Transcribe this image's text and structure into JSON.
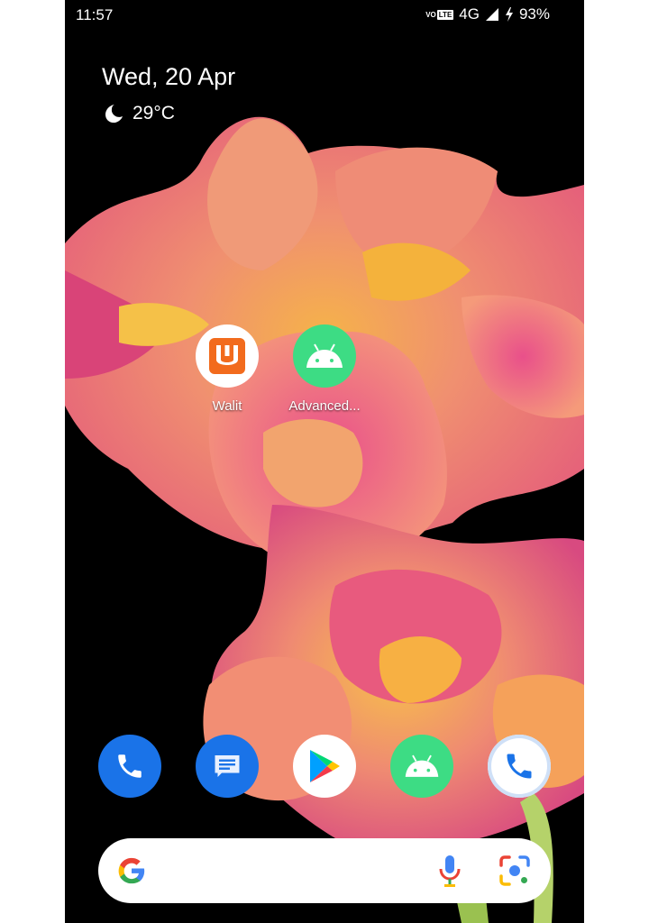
{
  "status_bar": {
    "time": "11:57",
    "volte_vo": "VO",
    "volte_lte": "LTE",
    "network": "4G",
    "battery": "93%",
    "icons": [
      "signal-icon",
      "charging-bolt-icon"
    ]
  },
  "widget": {
    "date": "Wed, 20 Apr",
    "temperature": "29°C",
    "weather_icon": "moon-icon"
  },
  "apps": [
    {
      "label": "Walit",
      "color": "#f26b1d",
      "icon": "walit-logo-icon"
    },
    {
      "label": "Advanced...",
      "color": "#3ddc84",
      "icon": "android-icon"
    }
  ],
  "dock": [
    {
      "name": "phone",
      "color": "#1a73e8",
      "icon": "phone-icon"
    },
    {
      "name": "messages",
      "color": "#1a73e8",
      "icon": "message-icon"
    },
    {
      "name": "play-store",
      "color": "#ffffff",
      "icon": "play-store-icon"
    },
    {
      "name": "android-app",
      "color": "#3ddc84",
      "icon": "android-icon"
    },
    {
      "name": "phone-outline",
      "color": "#ffffff",
      "icon": "phone-icon"
    }
  ],
  "search": {
    "icons": [
      "google-g-icon",
      "mic-icon",
      "lens-icon"
    ]
  }
}
